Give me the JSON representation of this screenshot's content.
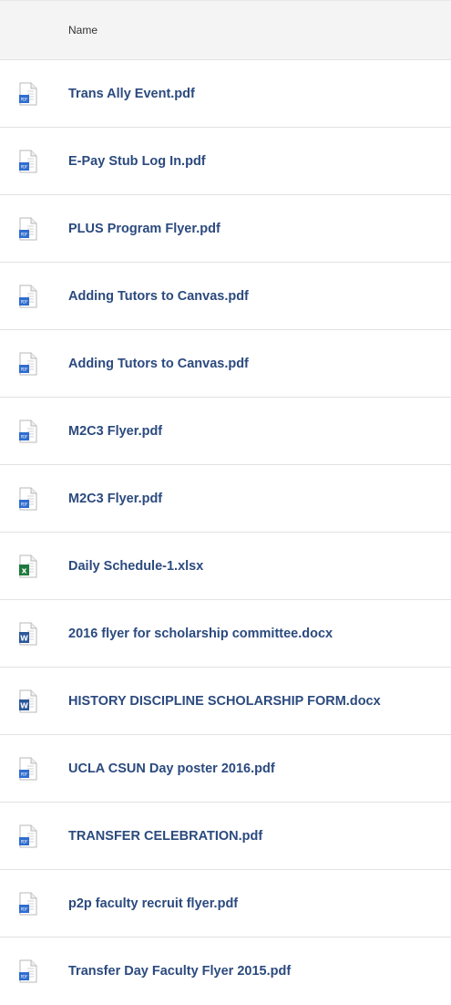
{
  "header": {
    "name_label": "Name"
  },
  "files": [
    {
      "name": "Trans Ally Event.pdf",
      "type": "pdf",
      "icon": "pdf-file-icon"
    },
    {
      "name": "E-Pay Stub Log In.pdf",
      "type": "pdf",
      "icon": "pdf-file-icon"
    },
    {
      "name": "PLUS Program Flyer.pdf",
      "type": "pdf",
      "icon": "pdf-file-icon"
    },
    {
      "name": "Adding Tutors to Canvas.pdf",
      "type": "pdf",
      "icon": "pdf-file-icon"
    },
    {
      "name": "Adding Tutors to Canvas.pdf",
      "type": "pdf",
      "icon": "pdf-file-icon"
    },
    {
      "name": "M2C3 Flyer.pdf",
      "type": "pdf",
      "icon": "pdf-file-icon"
    },
    {
      "name": "M2C3 Flyer.pdf",
      "type": "pdf",
      "icon": "pdf-file-icon"
    },
    {
      "name": "Daily Schedule-1.xlsx",
      "type": "xlsx",
      "icon": "excel-file-icon"
    },
    {
      "name": "2016 flyer for scholarship committee.docx",
      "type": "docx",
      "icon": "word-file-icon"
    },
    {
      "name": "HISTORY DISCIPLINE SCHOLARSHIP FORM.docx",
      "type": "docx",
      "icon": "word-file-icon"
    },
    {
      "name": "UCLA CSUN Day poster 2016.pdf",
      "type": "pdf",
      "icon": "pdf-file-icon"
    },
    {
      "name": "TRANSFER CELEBRATION.pdf",
      "type": "pdf",
      "icon": "pdf-file-icon"
    },
    {
      "name": "p2p faculty recruit flyer.pdf",
      "type": "pdf",
      "icon": "pdf-file-icon"
    },
    {
      "name": "Transfer Day Faculty Flyer 2015.pdf",
      "type": "pdf",
      "icon": "pdf-file-icon"
    }
  ],
  "colors": {
    "link": "#2b4a7e",
    "header_bg": "#f4f4f4",
    "divider": "#e2e2e2",
    "pdf_badge": "#2f6dd0",
    "excel_badge": "#1e7a3e",
    "word_badge": "#2b579a"
  }
}
